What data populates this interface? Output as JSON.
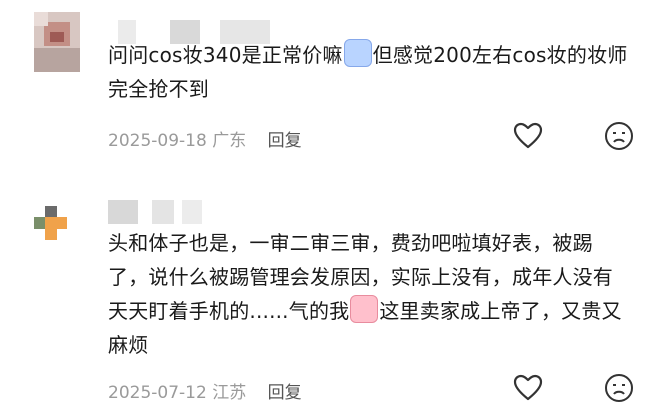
{
  "comments": [
    {
      "text": "问问cos妆340是正常价嘛",
      "text_after": "但感觉200左右cos妆的妆师完全抢不到",
      "emoji": "crying-emoji",
      "date": "2025-09-18",
      "location": "广东",
      "reply_label": "回复"
    },
    {
      "text": "头和体子也是，一审二审三审，费劲吧啦填好表，被踢了，说什么被踢管理会发原因，实际上没有，成年人没有天天盯着手机的......气的我",
      "text_after": "这里卖家成上帝了，又贵又麻烦",
      "emoji": "angry-emoji",
      "date": "2025-07-12",
      "location": "江苏",
      "reply_label": "回复"
    }
  ],
  "icons": {
    "like": "heart-outline-icon",
    "dislike": "frown-face-icon"
  },
  "colors": {
    "meta": "#9a9a9a",
    "reply": "#555555",
    "text": "#1a1a1a",
    "icon": "#333333"
  }
}
